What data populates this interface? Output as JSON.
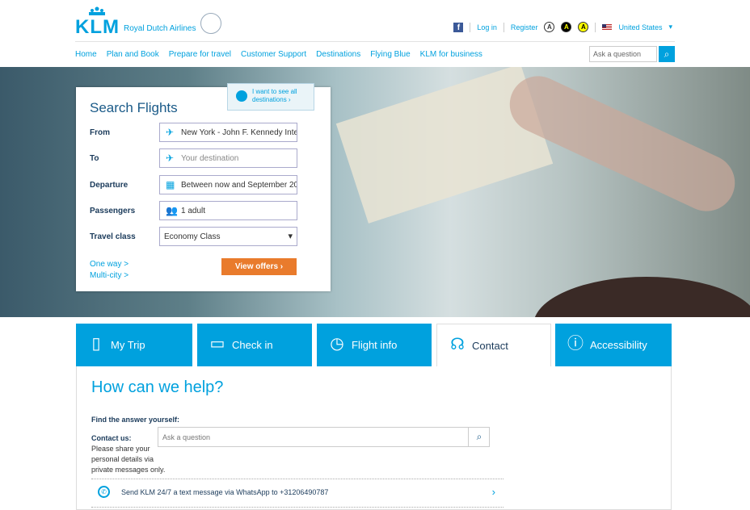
{
  "brand": {
    "name": "KLM",
    "sub": "Royal Dutch Airlines"
  },
  "top": {
    "login": "Log in",
    "register": "Register",
    "contrast": [
      "A",
      "A",
      "A"
    ],
    "country": "United States",
    "fb": "f"
  },
  "nav": {
    "items": [
      "Home",
      "Plan and Book",
      "Prepare for travel",
      "Customer Support",
      "Destinations",
      "Flying Blue",
      "KLM for business"
    ],
    "search_placeholder": "Ask a question"
  },
  "search": {
    "title": "Search Flights",
    "all_destinations": "I want to see all destinations ›",
    "labels": {
      "from": "From",
      "to": "To",
      "departure": "Departure",
      "passengers": "Passengers",
      "class": "Travel class"
    },
    "values": {
      "from": "New York - John F. Kennedy Inte",
      "to": "Your destination",
      "departure": "Between now and September 20",
      "passengers": "1 adult",
      "class": "Economy Class"
    },
    "one_way": "One way >",
    "multi_city": "Multi-city >",
    "view_offers": "View offers ›"
  },
  "tabs": [
    "My Trip",
    "Check in",
    "Flight info",
    "Contact",
    "Accessibility"
  ],
  "help": {
    "title": "How can we help?",
    "find": "Find the answer yourself:",
    "contact_us": "Contact us:",
    "share": "Please share your personal details via private messages only.",
    "ask_placeholder": "Ask a question",
    "whatsapp": "Send KLM 24/7 a text message via WhatsApp to +31206490787"
  },
  "colors": {
    "accent": "#00a1de",
    "orange": "#e97b2c"
  }
}
